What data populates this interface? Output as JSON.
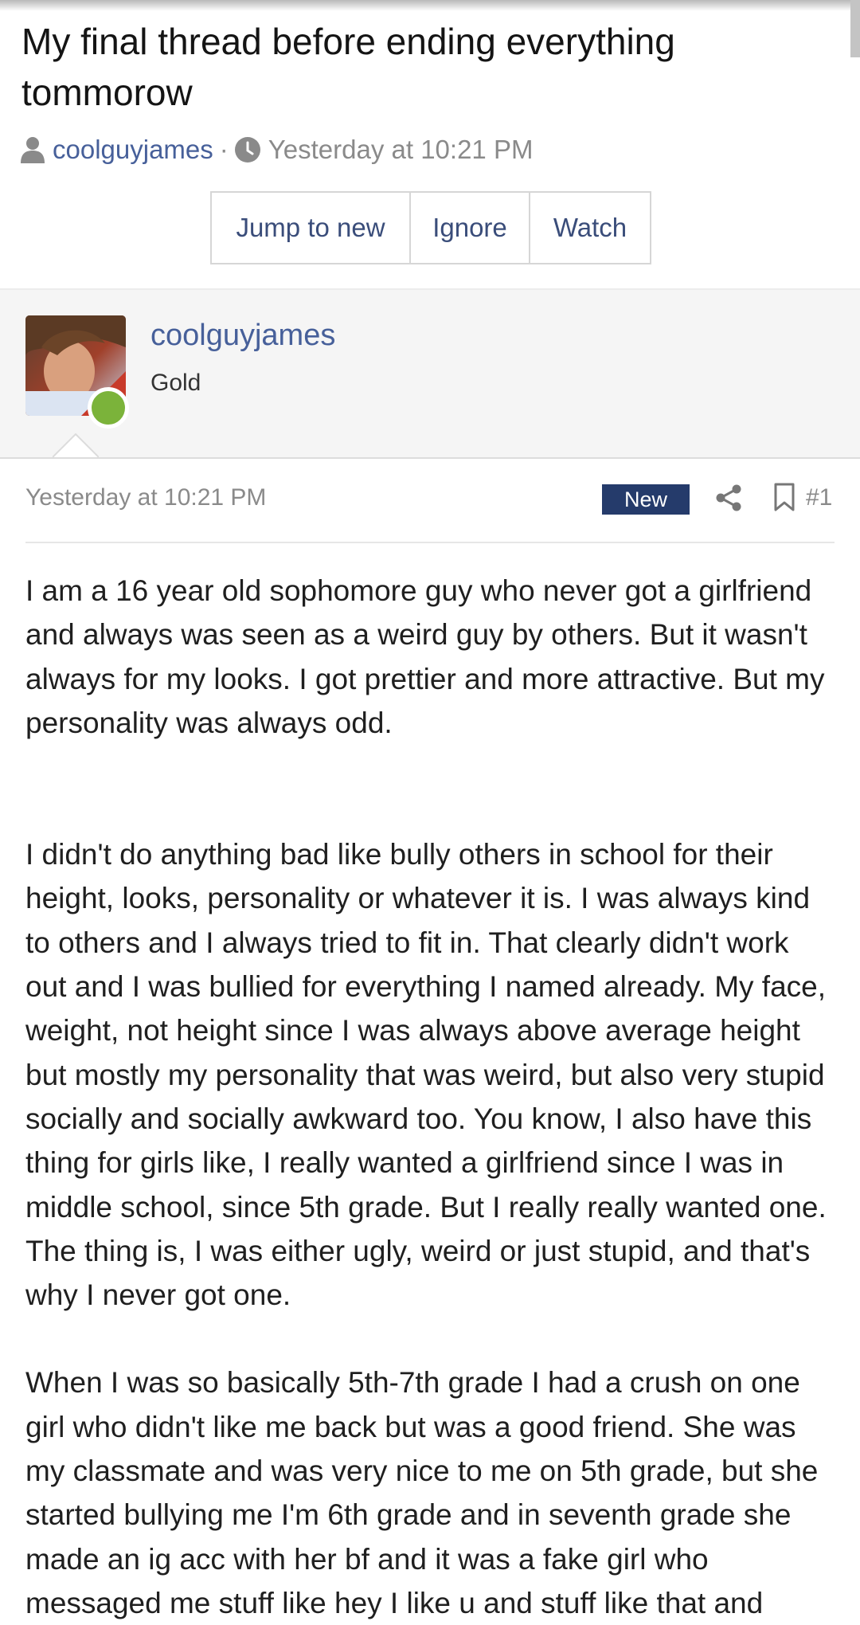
{
  "thread": {
    "title": "My final thread before ending everything tommorow",
    "author": "coolguyjames",
    "separator": "·",
    "posted": "Yesterday at 10:21 PM"
  },
  "actions": {
    "jump_label": "Jump to new",
    "ignore_label": "Ignore",
    "watch_label": "Watch"
  },
  "user": {
    "name": "coolguyjames",
    "rank": "Gold",
    "online_color": "#7bb33a"
  },
  "post": {
    "date": "Yesterday at 10:21 PM",
    "badge": "New",
    "number": "#1",
    "paragraphs": [
      "I am a 16 year old sophomore guy who never got a girlfriend and always was seen as a weird guy by others. But it wasn't always for my looks. I got prettier and more attractive. But my personality was always odd.",
      "I didn't do anything bad like bully others in school for their height, looks, personality or whatever it is. I was always kind to others and I always tried to fit in. That clearly didn't work out and I was bullied for everything I named already. My face, weight, not height since I was always above average height but mostly my personality that was weird, but also very stupid socially and socially awkward too. You know, I also have this thing for girls like, I really wanted a girlfriend since I was in middle school, since 5th grade. But I really really wanted one. The thing is, I was either ugly, weird or just stupid, and that's why I never got one.",
      "When I was so basically 5th-7th grade I had a crush on one girl who didn't like me back but was a good friend. She was my classmate and was very nice to me on 5th grade, but she started bullying me I'm 6th grade and in seventh grade she made an ig acc with her bf and it was a fake girl who messaged me stuff like hey I like u and stuff like that and"
    ]
  },
  "icons": {
    "user": "user-icon",
    "clock": "clock-icon",
    "share": "share-icon",
    "bookmark": "bookmark-icon"
  },
  "colors": {
    "link": "#47609a",
    "badge": "#253b6b",
    "muted": "#8a8a8a"
  }
}
